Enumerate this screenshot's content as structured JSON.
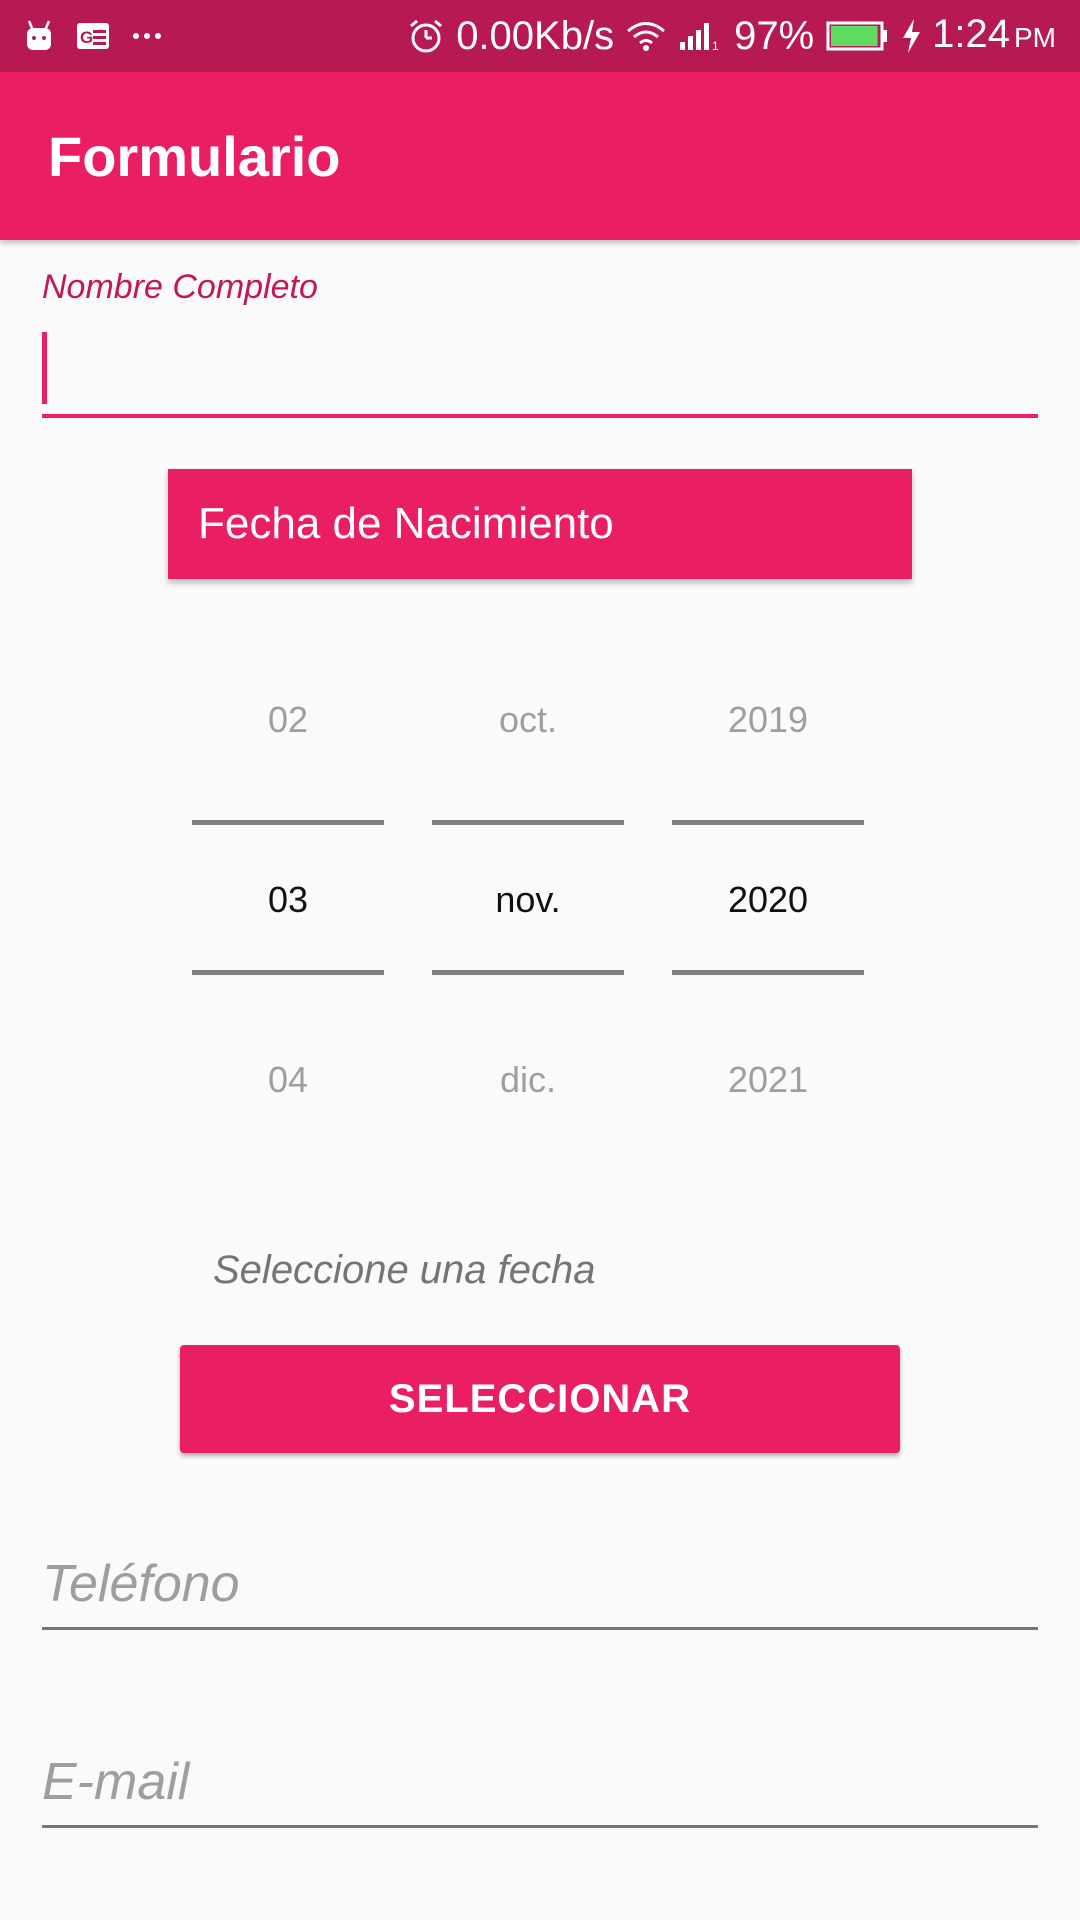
{
  "status_bar": {
    "icons_left": [
      "android-icon",
      "news-icon",
      "more-dots-icon"
    ],
    "alarm_icon": "alarm-icon",
    "network_speed": "0.00Kb/s",
    "wifi_icon": "wifi-icon",
    "signal_icon": "signal-icon",
    "battery_percent": "97%",
    "battery_level": 0.97,
    "battery_color": "#5fdb5f",
    "charging_icon": "bolt-icon",
    "time": "1:24",
    "ampm": "PM"
  },
  "app_bar": {
    "title": "Formulario",
    "color": "#e91e63"
  },
  "name_field": {
    "label": "Nombre Completo",
    "value": ""
  },
  "date_section": {
    "header": "Fecha de Nacimiento"
  },
  "date_picker": {
    "day": {
      "prev": "02",
      "current": "03",
      "next": "04"
    },
    "month": {
      "prev": "oct.",
      "current": "nov.",
      "next": "dic."
    },
    "year": {
      "prev": "2019",
      "current": "2020",
      "next": "2021"
    }
  },
  "select_hint": "Seleccione una fecha",
  "select_button_label": "SELECCIONAR",
  "phone_field": {
    "placeholder": "Teléfono",
    "value": ""
  },
  "email_field": {
    "placeholder": "E-mail",
    "value": ""
  },
  "colors": {
    "status_bar": "#b71a52",
    "primary": "#e91e63",
    "accent_label": "#c2185b"
  }
}
